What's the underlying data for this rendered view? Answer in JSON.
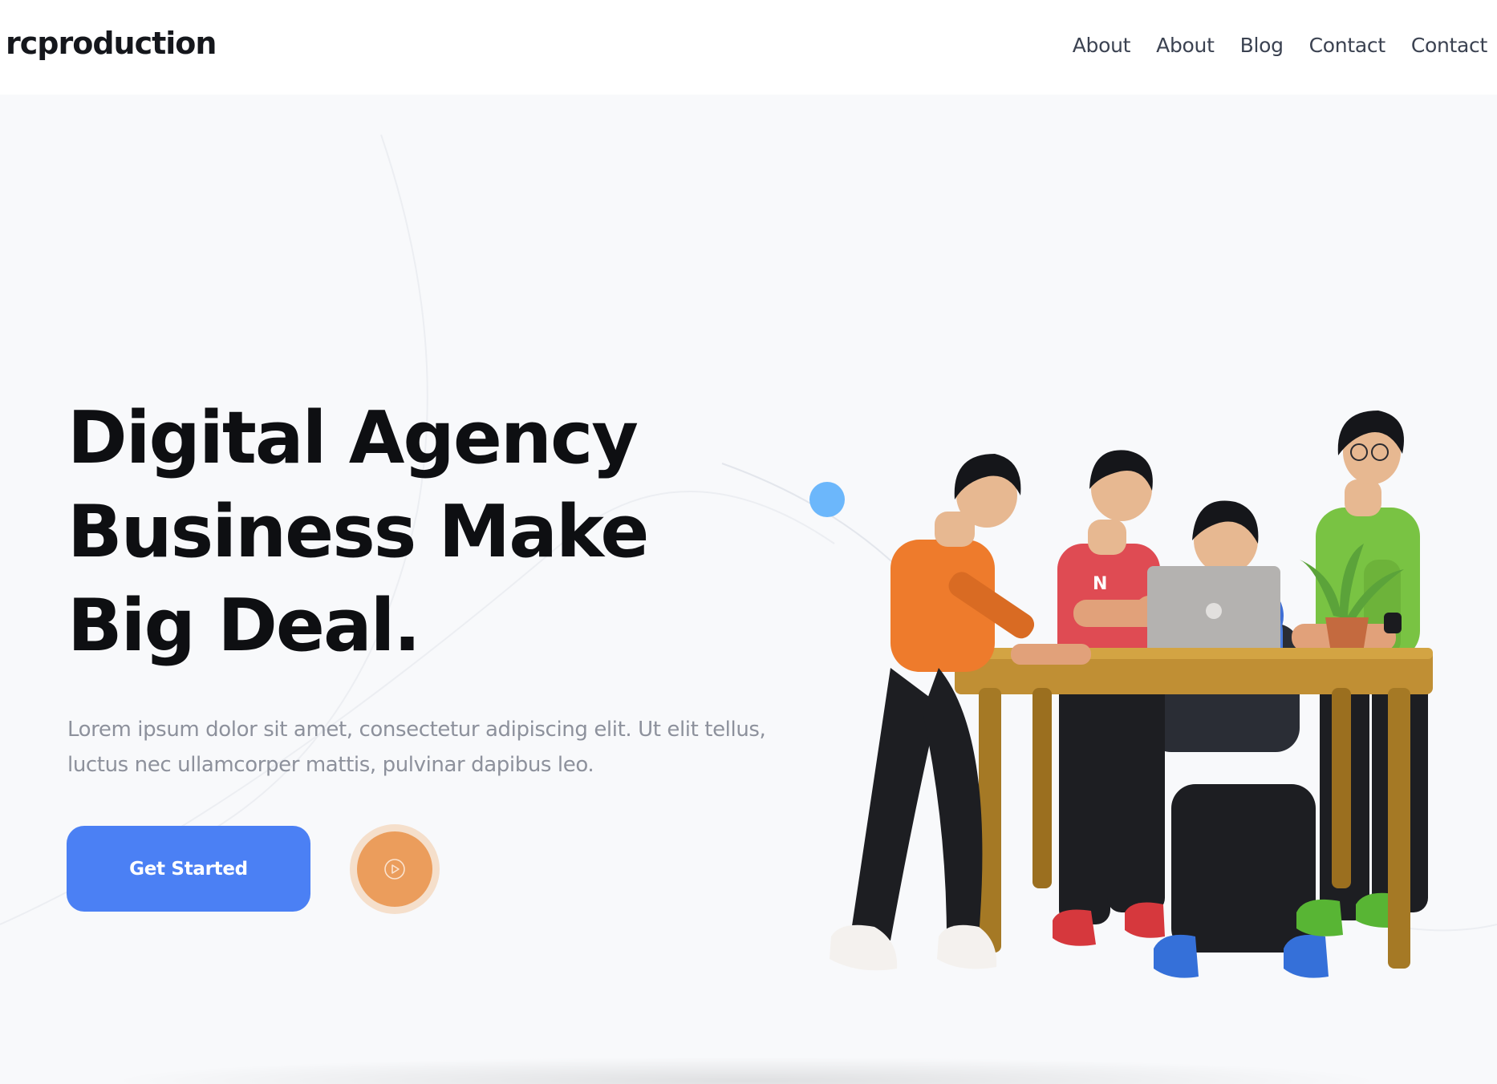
{
  "header": {
    "brand": "rcproduction",
    "nav": [
      "About",
      "About",
      "Blog",
      "Contact",
      "Contact"
    ]
  },
  "hero": {
    "headline_lines": [
      "Digital Agency",
      "Business Make",
      "Big Deal."
    ],
    "lede": "Lorem ipsum dolor sit amet, consectetur adipiscing elit. Ut elit tellus, luctus nec ullamcorper mattis, pulvinar dapibus leo.",
    "cta_label": "Get Started",
    "illustration_shirt_letter": "N"
  },
  "icons": {
    "play": "play-circle-icon",
    "illustration": "team-at-desk-illustration"
  },
  "colors": {
    "primary": "#4b80f4",
    "accent_orange": "#eb9d5c",
    "accent_orange_halo": "#f5dfcb",
    "blue_dot": "#6cb7fb",
    "headline": "#0e0f12",
    "body_text": "#8d919c",
    "nav_text": "#3b4251",
    "background": "#f8f9fb"
  }
}
